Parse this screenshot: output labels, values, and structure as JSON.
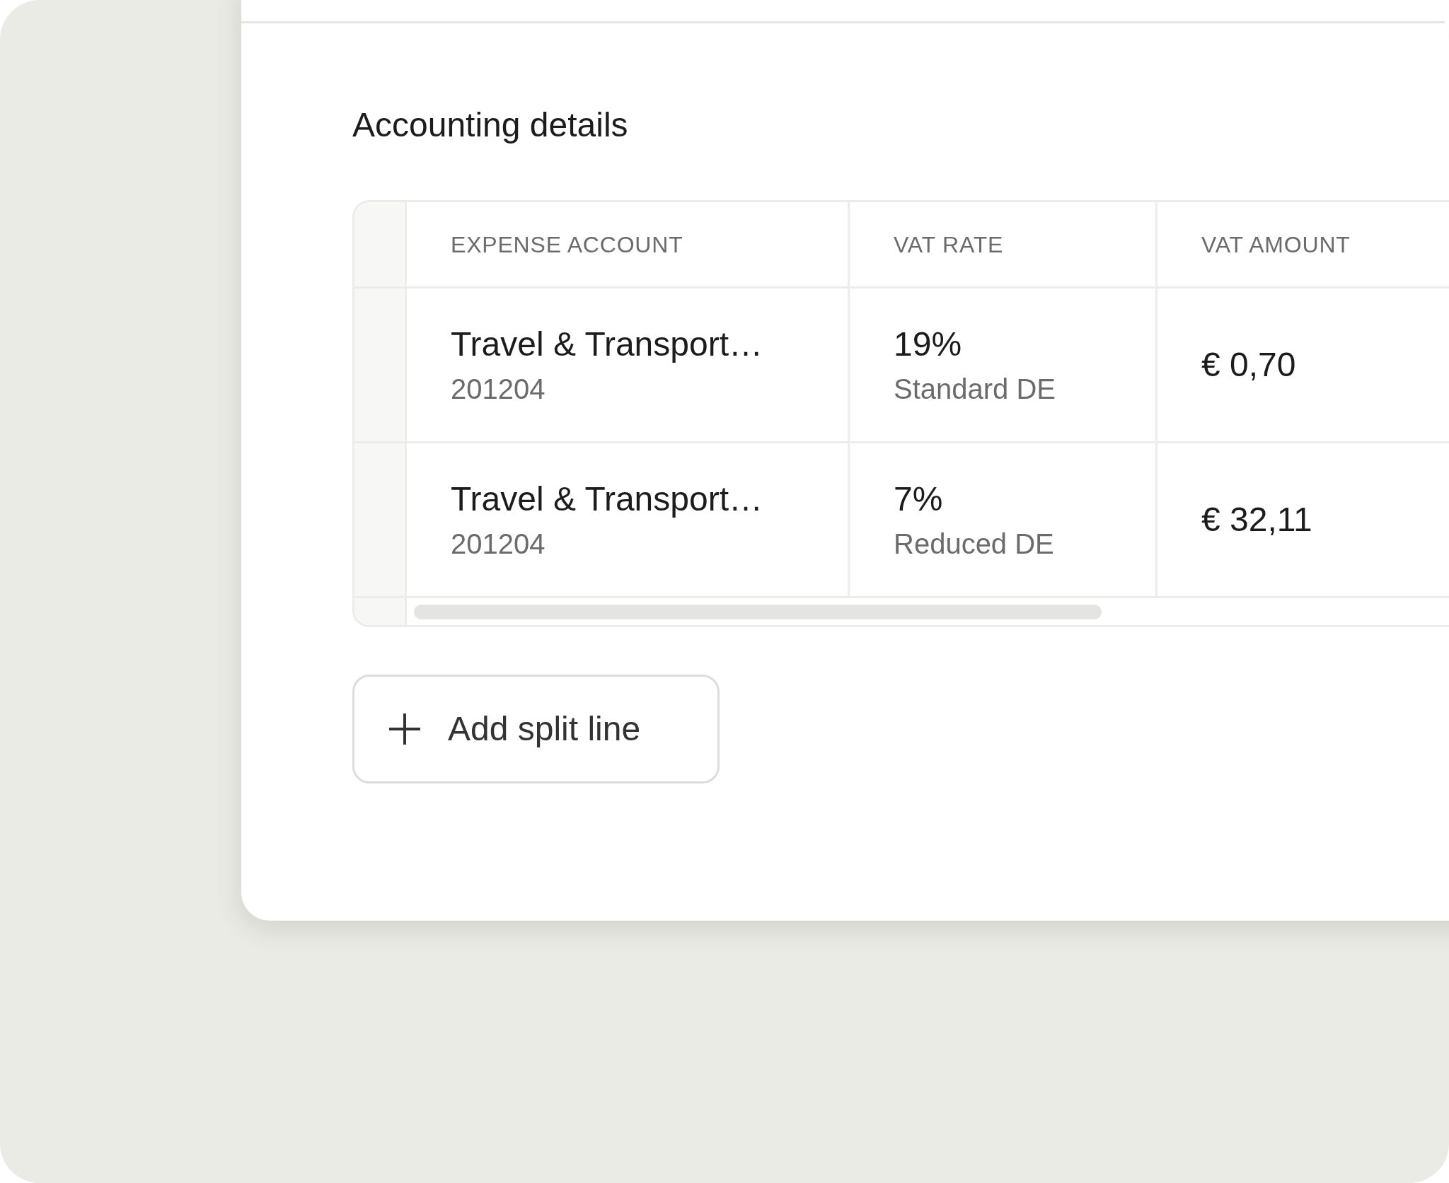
{
  "section": {
    "title": "Accounting details"
  },
  "table": {
    "columns": [
      "EXPENSE ACCOUNT",
      "VAT RATE",
      "VAT AMOUNT"
    ],
    "rows": [
      {
        "account": "Travel & Transport…",
        "account_code": "201204",
        "vat_rate": "19%",
        "vat_rate_name": "Standard DE",
        "vat_amount": "€ 0,70"
      },
      {
        "account": "Travel & Transport…",
        "account_code": "201204",
        "vat_rate": "7%",
        "vat_rate_name": "Reduced DE",
        "vat_amount": "€ 32,11"
      }
    ]
  },
  "add_button": {
    "label": "Add split line"
  }
}
